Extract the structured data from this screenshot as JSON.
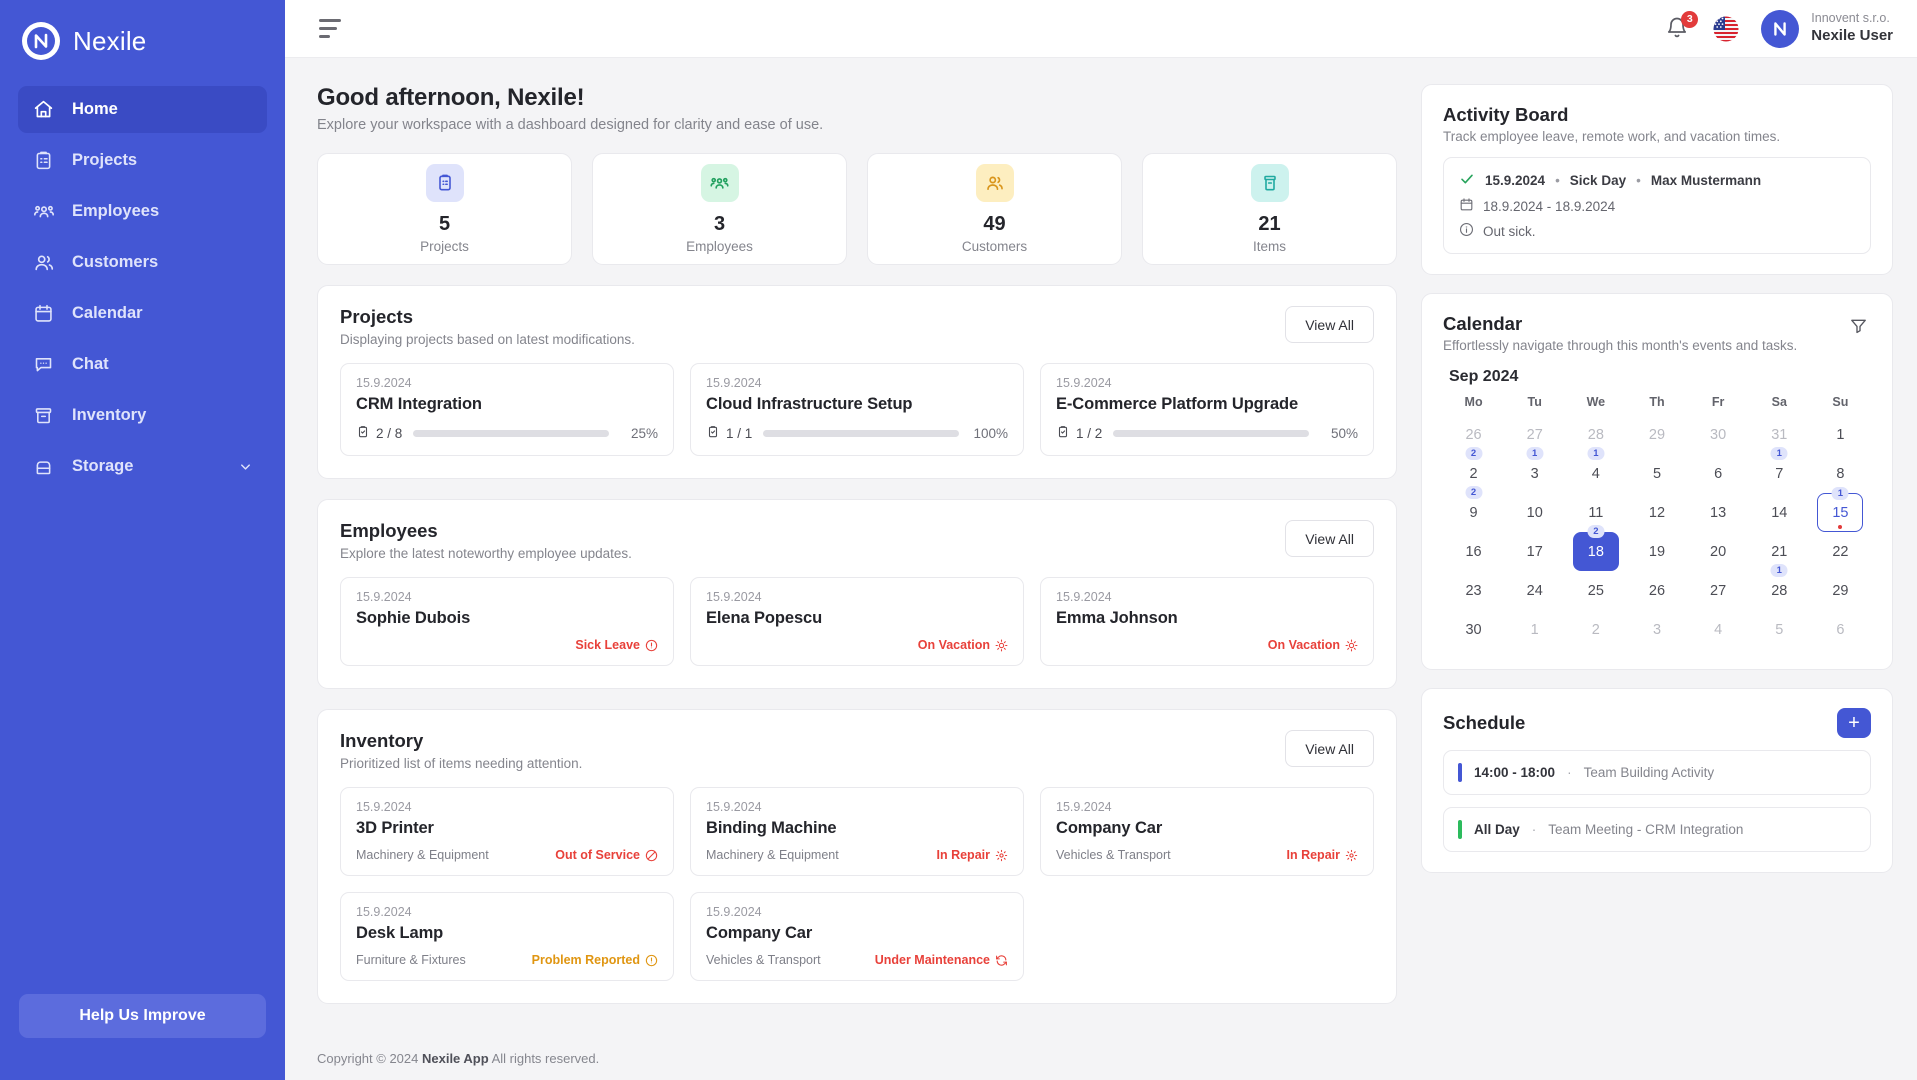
{
  "brand": {
    "name": "Nexile",
    "logo_letter": "N"
  },
  "sidebar": {
    "items": [
      {
        "label": "Home",
        "icon": "home-icon",
        "active": true
      },
      {
        "label": "Projects",
        "icon": "clipboard-icon",
        "active": false
      },
      {
        "label": "Employees",
        "icon": "employees-icon",
        "active": false
      },
      {
        "label": "Customers",
        "icon": "customers-icon",
        "active": false
      },
      {
        "label": "Calendar",
        "icon": "calendar-icon",
        "active": false
      },
      {
        "label": "Chat",
        "icon": "chat-icon",
        "active": false
      },
      {
        "label": "Inventory",
        "icon": "inventory-icon",
        "active": false
      },
      {
        "label": "Storage",
        "icon": "storage-icon",
        "active": false,
        "expandable": true
      }
    ],
    "help_button": "Help Us Improve",
    "active_bg": "#3a4bc4",
    "bg": "#4457d4"
  },
  "topbar": {
    "menu_icon": "hamburger-icon",
    "notifications": {
      "count": "3",
      "icon": "bell-icon",
      "badge_color": "#e23b3b"
    },
    "language": {
      "icon": "flag-us-icon"
    },
    "user": {
      "org": "Innovent s.r.o.",
      "name": "Nexile User",
      "avatar_letter": "N"
    }
  },
  "greeting": {
    "title": "Good afternoon, Nexile!",
    "subtitle": "Explore your workspace with a dashboard designed for clarity and ease of use."
  },
  "stats": [
    {
      "value": "5",
      "label": "Projects",
      "icon": "clipboard-icon",
      "bg": "#dfe3fb",
      "fg": "#4457d4"
    },
    {
      "value": "3",
      "label": "Employees",
      "icon": "employees-icon",
      "bg": "#d6f5e3",
      "fg": "#22a05f"
    },
    {
      "value": "49",
      "label": "Customers",
      "icon": "customers-icon",
      "bg": "#fdeec0",
      "fg": "#d9951b"
    },
    {
      "value": "21",
      "label": "Items",
      "icon": "inventory-icon",
      "bg": "#cdf2ee",
      "fg": "#1fa9a0"
    }
  ],
  "projects": {
    "title": "Projects",
    "subtitle": "Displaying projects based on latest modifications.",
    "view_all": "View All",
    "items": [
      {
        "date": "15.9.2024",
        "name": "CRM Integration",
        "tasks": "2 / 8",
        "percent": "25%",
        "percent_value": 25,
        "color": "#e23b3b"
      },
      {
        "date": "15.9.2024",
        "name": "Cloud Infrastructure Setup",
        "tasks": "1 / 1",
        "percent": "100%",
        "percent_value": 100,
        "color": "#22a05f"
      },
      {
        "date": "15.9.2024",
        "name": "E-Commerce Platform Upgrade",
        "tasks": "1 / 2",
        "percent": "50%",
        "percent_value": 50,
        "color": "#4457d4"
      }
    ]
  },
  "employees": {
    "title": "Employees",
    "subtitle": "Explore the latest noteworthy employee updates.",
    "view_all": "View All",
    "items": [
      {
        "date": "15.9.2024",
        "name": "Sophie Dubois",
        "status": "Sick Leave",
        "status_icon": "alert-circle-icon",
        "color": "#e8413a"
      },
      {
        "date": "15.9.2024",
        "name": "Elena Popescu",
        "status": "On Vacation",
        "status_icon": "sun-icon",
        "color": "#e8413a"
      },
      {
        "date": "15.9.2024",
        "name": "Emma Johnson",
        "status": "On Vacation",
        "status_icon": "sun-icon",
        "color": "#e8413a"
      }
    ]
  },
  "inventory": {
    "title": "Inventory",
    "subtitle": "Prioritized list of items needing attention.",
    "view_all": "View All",
    "items": [
      {
        "date": "15.9.2024",
        "name": "3D Printer",
        "category": "Machinery & Equipment",
        "status": "Out of Service",
        "status_icon": "ban-icon",
        "color": "#e8413a"
      },
      {
        "date": "15.9.2024",
        "name": "Binding Machine",
        "category": "Machinery & Equipment",
        "status": "In Repair",
        "status_icon": "gear-icon",
        "color": "#e8413a"
      },
      {
        "date": "15.9.2024",
        "name": "Company Car",
        "category": "Vehicles & Transport",
        "status": "In Repair",
        "status_icon": "gear-icon",
        "color": "#e8413a"
      },
      {
        "date": "15.9.2024",
        "name": "Desk Lamp",
        "category": "Furniture & Fixtures",
        "status": "Problem Reported",
        "status_icon": "alert-circle-icon",
        "color": "#e09612"
      },
      {
        "date": "15.9.2024",
        "name": "Company Car",
        "category": "Vehicles & Transport",
        "status": "Under Maintenance",
        "status_icon": "refresh-icon",
        "color": "#e8413a"
      }
    ]
  },
  "activity_board": {
    "title": "Activity Board",
    "subtitle": "Track employee leave, remote work, and vacation times.",
    "entry": {
      "check_icon": "check-icon",
      "date": "15.9.2024",
      "sep1": "•",
      "type": "Sick Day",
      "sep2": "•",
      "person": "Max Mustermann",
      "range_icon": "calendar-icon",
      "range": "18.9.2024 - 18.9.2024",
      "note_icon": "info-icon",
      "note": "Out sick."
    }
  },
  "calendar": {
    "title": "Calendar",
    "subtitle": "Effortlessly navigate through this month's events and tasks.",
    "filter_icon": "filter-icon",
    "month": "Sep 2024",
    "weekdays": [
      "Mo",
      "Tu",
      "We",
      "Th",
      "Fr",
      "Sa",
      "Su"
    ],
    "days": [
      {
        "n": "26",
        "muted": true
      },
      {
        "n": "27",
        "muted": true
      },
      {
        "n": "28",
        "muted": true
      },
      {
        "n": "29",
        "muted": true
      },
      {
        "n": "30",
        "muted": true
      },
      {
        "n": "31",
        "muted": true
      },
      {
        "n": "1"
      },
      {
        "n": "2",
        "badge": "2"
      },
      {
        "n": "3",
        "badge": "1"
      },
      {
        "n": "4",
        "badge": "1"
      },
      {
        "n": "5"
      },
      {
        "n": "6"
      },
      {
        "n": "7",
        "badge": "1"
      },
      {
        "n": "8"
      },
      {
        "n": "9",
        "badge": "2"
      },
      {
        "n": "10"
      },
      {
        "n": "11"
      },
      {
        "n": "12"
      },
      {
        "n": "13"
      },
      {
        "n": "14"
      },
      {
        "n": "15",
        "badge": "1",
        "today": true,
        "dot": true
      },
      {
        "n": "16"
      },
      {
        "n": "17"
      },
      {
        "n": "18",
        "badge": "2",
        "selected": true
      },
      {
        "n": "19"
      },
      {
        "n": "20"
      },
      {
        "n": "21"
      },
      {
        "n": "22"
      },
      {
        "n": "23"
      },
      {
        "n": "24"
      },
      {
        "n": "25"
      },
      {
        "n": "26"
      },
      {
        "n": "27"
      },
      {
        "n": "28",
        "badge": "1"
      },
      {
        "n": "29"
      },
      {
        "n": "30"
      },
      {
        "n": "1",
        "muted": true
      },
      {
        "n": "2",
        "muted": true
      },
      {
        "n": "3",
        "muted": true
      },
      {
        "n": "4",
        "muted": true
      },
      {
        "n": "5",
        "muted": true
      },
      {
        "n": "6",
        "muted": true
      }
    ]
  },
  "schedule": {
    "title": "Schedule",
    "add_label": "+",
    "items": [
      {
        "time": "14:00 - 18:00",
        "sep": "·",
        "text": "Team Building Activity",
        "color": "#4457d4"
      },
      {
        "time": "All Day",
        "sep": "·",
        "text": "Team Meeting - CRM Integration",
        "color": "#2cbb5d"
      }
    ]
  },
  "footer": {
    "prefix": "Copyright © 2024 ",
    "brand": "Nexile App",
    "suffix": " All rights reserved."
  }
}
